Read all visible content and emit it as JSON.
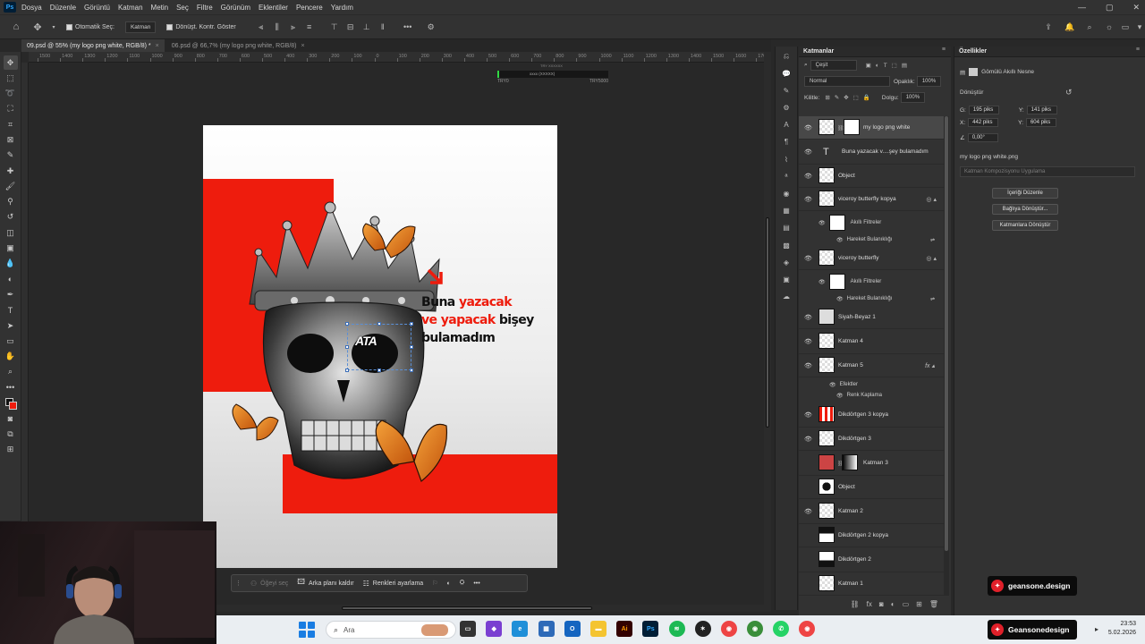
{
  "menubar": {
    "app_logo": "Ps",
    "items": [
      "Dosya",
      "Düzenle",
      "Görüntü",
      "Katman",
      "Metin",
      "Seç",
      "Filtre",
      "Görünüm",
      "Eklentiler",
      "Pencere",
      "Yardım"
    ],
    "window_controls": [
      "—",
      "▢",
      "✕"
    ]
  },
  "options": {
    "auto_select_label": "Otomatik Seç:",
    "auto_select_value": "Katman",
    "transform_label": "Dönüşt. Kontr. Göster"
  },
  "tabs": [
    {
      "label": "09.psd @ 55% (my logo png white, RGB/8) *",
      "active": true
    },
    {
      "label": "06.psd @ 66,7% (my logo png white, RGB/8)",
      "active": false
    }
  ],
  "ruler": {
    "labels": [
      "1500",
      "1400",
      "1300",
      "1200",
      "1100",
      "1000",
      "900",
      "800",
      "700",
      "600",
      "500",
      "400",
      "300",
      "200",
      "100",
      "0",
      "100",
      "200",
      "300",
      "400",
      "500",
      "600",
      "700",
      "800",
      "900",
      "1000",
      "1100",
      "1200",
      "1300",
      "1400",
      "1500",
      "1600",
      "1700"
    ]
  },
  "canvas": {
    "headline_l1_red": "yazacak",
    "headline_l1_dark": "Buna ",
    "headline_l2_red": "ve yapacak",
    "headline_l2_dark": " bişey",
    "headline_l3": "bulamadım",
    "logo_text": "ATA"
  },
  "trial": {
    "top": "TRY XXXXXX",
    "caption": "xxxx (XXXXX)",
    "left": "TRY0",
    "right": "TRY5000",
    "progress_percent": 2
  },
  "context_bar": {
    "item_dim": "Öğeyi seç",
    "remove_bg": "Arka planı kaldır",
    "adjust_colors": "Renkleri ayarlama",
    "more": "•••"
  },
  "layers_panel": {
    "title": "Katmanlar",
    "filter": "Çeşit",
    "blend_mode": "Normal",
    "opacity_label": "Opaklık:",
    "opacity_value": "100%",
    "lock_label": "Kilitle:",
    "fill_label": "Dolgu:",
    "fill_value": "100%",
    "layers": [
      {
        "name": "my logo png white",
        "visible": true,
        "selected": true,
        "kind": "mask"
      },
      {
        "name": "Buna yazacak v....şey bulamadım",
        "visible": true,
        "kind": "text"
      },
      {
        "name": "Object",
        "visible": true,
        "kind": "pixel"
      },
      {
        "name": "viceroy butterfly kopya",
        "visible": true,
        "kind": "smart"
      },
      {
        "name": "viceroy butterfly",
        "visible": true,
        "kind": "smart"
      },
      {
        "name": "Siyah-Beyaz 1",
        "visible": true,
        "kind": "adjust"
      },
      {
        "name": "Katman 4",
        "visible": true,
        "kind": "pixel"
      },
      {
        "name": "Katman 5",
        "visible": true,
        "kind": "fx"
      },
      {
        "name": "Dikdörtgen 3 kopya",
        "visible": true,
        "kind": "red"
      },
      {
        "name": "Dikdörtgen 3",
        "visible": true,
        "kind": "pixel"
      },
      {
        "name": "Katman 3",
        "visible": false,
        "kind": "mask"
      },
      {
        "name": "Object",
        "visible": false,
        "kind": "dark"
      },
      {
        "name": "Katman 2",
        "visible": true,
        "kind": "pixel"
      },
      {
        "name": "Dikdörtgen 2 kopya",
        "visible": false,
        "kind": "dark"
      },
      {
        "name": "Dikdörtgen 2",
        "visible": false,
        "kind": "dark"
      },
      {
        "name": "Katman 1",
        "visible": false,
        "kind": "pixel"
      }
    ],
    "smart_filters": "Akıllı Filtreler",
    "motion_blur": "Hareket Bulanıklığı",
    "effects": "Efektler",
    "color_overlay": "Renk Kaplama"
  },
  "properties_panel": {
    "title": "Özellikler",
    "kind": "Gömülü Akıllı Nesne",
    "transform": "Dönüştür",
    "w_label": "G:",
    "w_value": "195 piks",
    "h_label": "Y:",
    "h_value": "141 piks",
    "x_label": "X:",
    "x_value": "442 piks",
    "y_label": "Y:",
    "y_value": "604 piks",
    "angle": "0,00°",
    "file_name": "my logo png white.png",
    "comp_placeholder": "Katman Kompozisyonu Uygulama",
    "btn_edit": "İçeriği Düzenle",
    "btn_convert_linked": "Bağlıya Dönüştür...",
    "btn_convert_layers": "Katmanlara Dönüştür"
  },
  "badges": {
    "top": "geansone.design",
    "bottom": "Geansonedesign"
  },
  "taskbar": {
    "search": "Ara",
    "time": "23:53",
    "date": "5.02.2026"
  }
}
